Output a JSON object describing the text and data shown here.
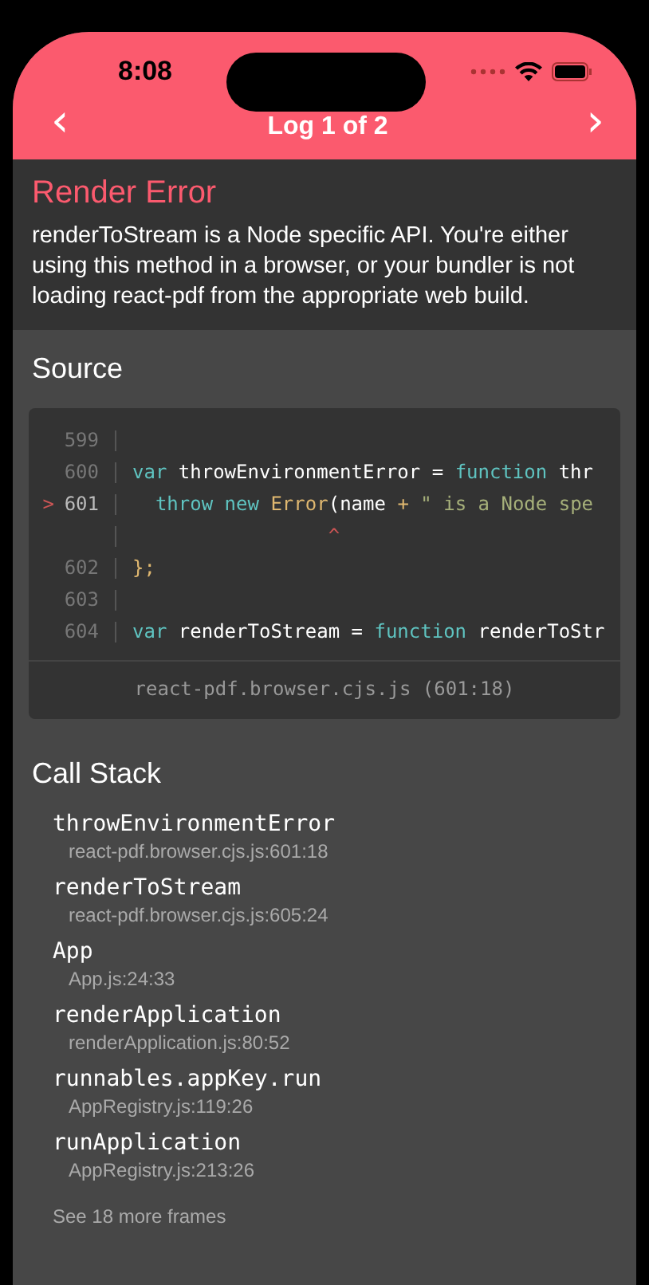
{
  "status_bar": {
    "time": "8:08"
  },
  "header": {
    "prev": "‹",
    "title": "Log 1 of 2",
    "next": "›"
  },
  "error": {
    "title": "Render Error",
    "message": "renderToStream is a Node specific API. You're either using this method in a browser, or your bundler is not loading react-pdf from the appropriate web build."
  },
  "source": {
    "heading": "Source",
    "lines": [
      {
        "number": "599",
        "highlighted": false
      },
      {
        "number": "600",
        "highlighted": false,
        "tokens": [
          {
            "text": "var",
            "kind": "keyword"
          },
          {
            "text": " throwEnvironmentError = ",
            "kind": "plain"
          },
          {
            "text": "function",
            "kind": "keyword"
          },
          {
            "text": " thr",
            "kind": "plain"
          }
        ]
      },
      {
        "number": "601",
        "highlighted": true,
        "marker": ">",
        "tokens": [
          {
            "text": "  throw",
            "kind": "keyword"
          },
          {
            "text": " new",
            "kind": "keyword"
          },
          {
            "text": " Error",
            "kind": "name"
          },
          {
            "text": "(name ",
            "kind": "plain"
          },
          {
            "text": "+",
            "kind": "name"
          },
          {
            "text": " \" is a Node spe",
            "kind": "string"
          }
        ]
      },
      {
        "caret": "                 ^"
      },
      {
        "number": "602",
        "highlighted": false,
        "tokens": [
          {
            "text": "};",
            "kind": "name"
          }
        ]
      },
      {
        "number": "603",
        "highlighted": false
      },
      {
        "number": "604",
        "highlighted": false,
        "tokens": [
          {
            "text": "var",
            "kind": "keyword"
          },
          {
            "text": " renderToStream = ",
            "kind": "plain"
          },
          {
            "text": "function",
            "kind": "keyword"
          },
          {
            "text": " renderToStr",
            "kind": "plain"
          }
        ]
      }
    ],
    "file": "react-pdf.browser.cjs.js (601:18)"
  },
  "call_stack": {
    "heading": "Call Stack",
    "frames": [
      {
        "name": "throwEnvironmentError",
        "location": "react-pdf.browser.cjs.js:601:18"
      },
      {
        "name": "renderToStream",
        "location": "react-pdf.browser.cjs.js:605:24"
      },
      {
        "name": "App",
        "location": "App.js:24:33"
      },
      {
        "name": "renderApplication",
        "location": "renderApplication.js:80:52"
      },
      {
        "name": "runnables.appKey.run",
        "location": "AppRegistry.js:119:26"
      },
      {
        "name": "runApplication",
        "location": "AppRegistry.js:213:26"
      }
    ],
    "more": "See 18 more frames"
  }
}
